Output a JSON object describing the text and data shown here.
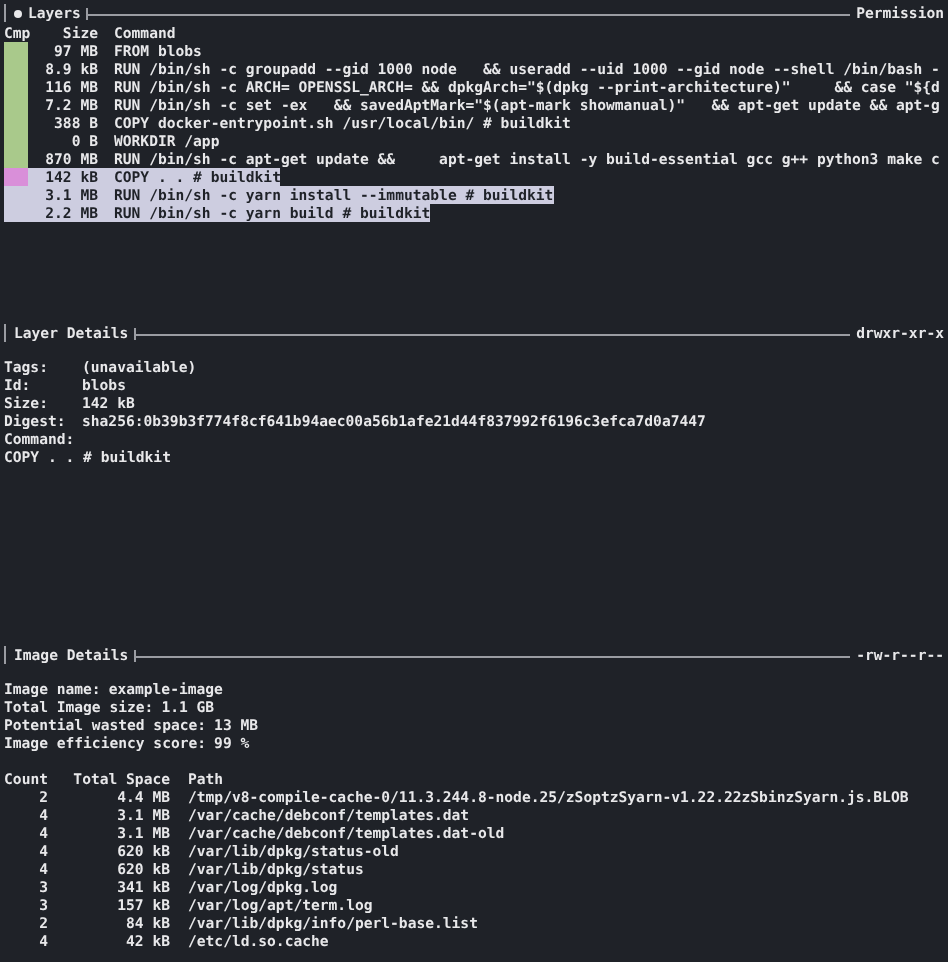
{
  "layers": {
    "title": "Layers",
    "focused": true,
    "permission": "Permission",
    "columns": [
      "Cmp",
      "Size",
      "Command"
    ],
    "rows": [
      {
        "size": "97 MB",
        "command": "FROM blobs",
        "color": "#a9c98b",
        "highlighted": false
      },
      {
        "size": "8.9 kB",
        "command": "RUN /bin/sh -c groupadd --gid 1000 node   && useradd --uid 1000 --gid node --shell /bin/bash -",
        "color": "#a9c98b",
        "highlighted": false
      },
      {
        "size": "116 MB",
        "command": "RUN /bin/sh -c ARCH= OPENSSL_ARCH= && dpkgArch=\"$(dpkg --print-architecture)\"     && case \"${d",
        "color": "#a9c98b",
        "highlighted": false
      },
      {
        "size": "7.2 MB",
        "command": "RUN /bin/sh -c set -ex   && savedAptMark=\"$(apt-mark showmanual)\"   && apt-get update && apt-g",
        "color": "#a9c98b",
        "highlighted": false
      },
      {
        "size": "388 B",
        "command": "COPY docker-entrypoint.sh /usr/local/bin/ # buildkit",
        "color": "#a9c98b",
        "highlighted": false
      },
      {
        "size": "0 B",
        "command": "WORKDIR /app",
        "color": "#a9c98b",
        "highlighted": false
      },
      {
        "size": "870 MB",
        "command": "RUN /bin/sh -c apt-get update &&     apt-get install -y build-essential gcc g++ python3 make c",
        "color": "#a9c98b",
        "highlighted": false
      },
      {
        "size": "142 kB",
        "command": "COPY . . # buildkit",
        "color": "#d98fd9",
        "highlighted": true
      },
      {
        "size": "3.1 MB",
        "command": "RUN /bin/sh -c yarn install --immutable # buildkit",
        "color": "#cdcde0",
        "highlighted": true
      },
      {
        "size": "2.2 MB",
        "command": "RUN /bin/sh -c yarn build # buildkit",
        "color": "#cdcde0",
        "highlighted": true
      }
    ]
  },
  "layer_details": {
    "title": "Layer Details",
    "permission": "drwxr-xr-x",
    "fields": [
      {
        "kind": "inline",
        "label": "Tags:",
        "value": "(unavailable)"
      },
      {
        "kind": "inline",
        "label": "Id:",
        "value": "blobs"
      },
      {
        "kind": "inline",
        "label": "Size:",
        "value": "142 kB"
      },
      {
        "kind": "inline",
        "label": "Digest:",
        "value": "sha256:0b39b3f774f8cf641b94aec00a56b1afe21d44f837992f6196c3efca7d0a7447"
      },
      {
        "kind": "block",
        "label": "Command:",
        "value": "COPY . . # buildkit"
      }
    ]
  },
  "image_details": {
    "title": "Image Details",
    "permission": "-rw-r--r--",
    "summary": [
      {
        "label": "Image name:",
        "value": "example-image"
      },
      {
        "label": "Total Image size:",
        "value": "1.1 GB"
      },
      {
        "label": "Potential wasted space:",
        "value": "13 MB"
      },
      {
        "label": "Image efficiency score:",
        "value": "99 %"
      }
    ],
    "columns": [
      "Count",
      "Total Space",
      "Path"
    ],
    "rows": [
      {
        "count": "2",
        "space": "4.4 MB",
        "path": "/tmp/v8-compile-cache-0/11.3.244.8-node.25/zSoptzSyarn-v1.22.22zSbinzSyarn.js.BLOB"
      },
      {
        "count": "4",
        "space": "3.1 MB",
        "path": "/var/cache/debconf/templates.dat"
      },
      {
        "count": "4",
        "space": "3.1 MB",
        "path": "/var/cache/debconf/templates.dat-old"
      },
      {
        "count": "4",
        "space": "620 kB",
        "path": "/var/lib/dpkg/status-old"
      },
      {
        "count": "4",
        "space": "620 kB",
        "path": "/var/lib/dpkg/status"
      },
      {
        "count": "3",
        "space": "341 kB",
        "path": "/var/log/dpkg.log"
      },
      {
        "count": "3",
        "space": "157 kB",
        "path": "/var/log/apt/term.log"
      },
      {
        "count": "2",
        "space": "84 kB",
        "path": "/var/lib/dpkg/info/perl-base.list"
      },
      {
        "count": "4",
        "space": "42 kB",
        "path": "/etc/ld.so.cache"
      }
    ]
  }
}
